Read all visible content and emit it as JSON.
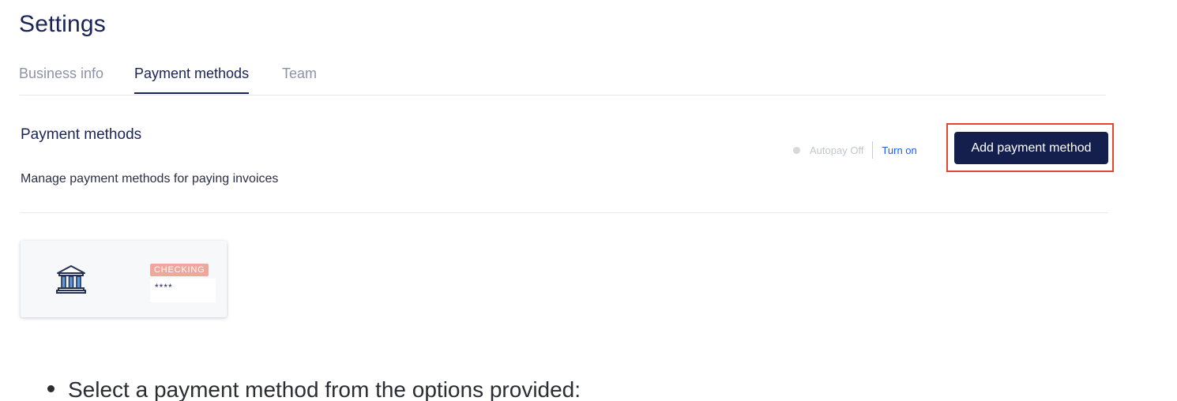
{
  "page": {
    "title": "Settings"
  },
  "tabs": [
    {
      "label": "Business info",
      "active": false
    },
    {
      "label": "Payment methods",
      "active": true
    },
    {
      "label": "Team",
      "active": false
    }
  ],
  "section": {
    "title": "Payment methods",
    "description": "Manage payment methods for paying invoices"
  },
  "autopay": {
    "status": "Autopay Off",
    "action_label": "Turn on"
  },
  "add_button": {
    "label": "Add payment method"
  },
  "payment_card": {
    "icon": "bank-icon",
    "badge": "CHECKING",
    "masked_number": "****"
  },
  "instruction": {
    "text": "Select a payment method from the options provided:"
  },
  "colors": {
    "primary": "#151f4d",
    "link": "#1f5fd6",
    "badge": "#f0a79b",
    "highlight": "#e2462b"
  }
}
